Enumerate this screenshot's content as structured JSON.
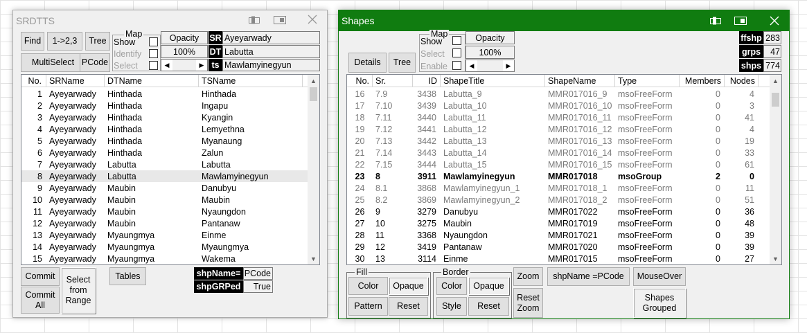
{
  "srdtts": {
    "title": "SRDTTS",
    "buttons": {
      "find": "Find",
      "onetwothree": "1->2,3",
      "tree": "Tree",
      "multiselect": "MultiSelect",
      "pcode": "PCode",
      "commit": "Commit",
      "commit_all": "Commit All",
      "select_from_range": "Select from Range",
      "tables": "Tables"
    },
    "map": {
      "label": "Map",
      "show": "Show",
      "identify": "Identify",
      "select": "Select"
    },
    "opacity": {
      "label": "Opacity",
      "value": "100%"
    },
    "tags": {
      "sr": "SR",
      "dt": "DT",
      "ts": "ts"
    },
    "fields": {
      "sr": "Ayeyarwady",
      "dt": "Labutta",
      "ts": "Mawlamyinegyun"
    },
    "columns": [
      "No.",
      "SRName",
      "DTName",
      "TSName"
    ],
    "rows": [
      [
        "1",
        "Ayeyarwady",
        "Hinthada",
        "Hinthada"
      ],
      [
        "2",
        "Ayeyarwady",
        "Hinthada",
        "Ingapu"
      ],
      [
        "3",
        "Ayeyarwady",
        "Hinthada",
        "Kyangin"
      ],
      [
        "4",
        "Ayeyarwady",
        "Hinthada",
        "Lemyethna"
      ],
      [
        "5",
        "Ayeyarwady",
        "Hinthada",
        "Myanaung"
      ],
      [
        "6",
        "Ayeyarwady",
        "Hinthada",
        "Zalun"
      ],
      [
        "7",
        "Ayeyarwady",
        "Labutta",
        "Labutta"
      ],
      [
        "8",
        "Ayeyarwady",
        "Labutta",
        "Mawlamyinegyun"
      ],
      [
        "9",
        "Ayeyarwady",
        "Maubin",
        "Danubyu"
      ],
      [
        "10",
        "Ayeyarwady",
        "Maubin",
        "Maubin"
      ],
      [
        "11",
        "Ayeyarwady",
        "Maubin",
        "Nyaungdon"
      ],
      [
        "12",
        "Ayeyarwady",
        "Maubin",
        "Pantanaw"
      ],
      [
        "13",
        "Ayeyarwady",
        "Myaungmya",
        "Einme"
      ],
      [
        "14",
        "Ayeyarwady",
        "Myaungmya",
        "Myaungmya"
      ],
      [
        "15",
        "Ayeyarwady",
        "Myaungmya",
        "Wakema"
      ]
    ],
    "selected_row": 7,
    "shpname": {
      "label": "shpName=",
      "value": "PCode"
    },
    "shpgrped": {
      "label": "shpGRPed",
      "value": "True"
    }
  },
  "shapes": {
    "title": "Shapes",
    "accent": "#107c10",
    "buttons": {
      "details": "Details",
      "tree": "Tree",
      "zoom": "Zoom",
      "reset_zoom": "Reset Zoom",
      "shpname_pcode": "shpName =PCode",
      "mouseover": "MouseOver",
      "shapes_grouped": "Shapes Grouped"
    },
    "map": {
      "label": "Map",
      "show": "Show",
      "select": "Select",
      "enable": "Enable"
    },
    "opacity": {
      "label": "Opacity",
      "value": "100%"
    },
    "stats": [
      {
        "label": "ffshp",
        "value": "283"
      },
      {
        "label": "grps",
        "value": "47"
      },
      {
        "label": "shps",
        "value": "774"
      }
    ],
    "columns": [
      "No.",
      "Sr.",
      "ID",
      "ShapeTitle",
      "ShapeName",
      "Type",
      "Members",
      "Nodes"
    ],
    "rows": [
      {
        "c": [
          "16",
          "7.9",
          "3438",
          "Labutta_9",
          "MMR017016_9",
          "msoFreeForm",
          "0",
          "4"
        ],
        "s": "gray"
      },
      {
        "c": [
          "17",
          "7.10",
          "3439",
          "Labutta_10",
          "MMR017016_10",
          "msoFreeForm",
          "0",
          "3"
        ],
        "s": "gray"
      },
      {
        "c": [
          "18",
          "7.11",
          "3440",
          "Labutta_11",
          "MMR017016_11",
          "msoFreeForm",
          "0",
          "41"
        ],
        "s": "gray"
      },
      {
        "c": [
          "19",
          "7.12",
          "3441",
          "Labutta_12",
          "MMR017016_12",
          "msoFreeForm",
          "0",
          "4"
        ],
        "s": "gray"
      },
      {
        "c": [
          "20",
          "7.13",
          "3442",
          "Labutta_13",
          "MMR017016_13",
          "msoFreeForm",
          "0",
          "19"
        ],
        "s": "gray"
      },
      {
        "c": [
          "21",
          "7.14",
          "3443",
          "Labutta_14",
          "MMR017016_14",
          "msoFreeForm",
          "0",
          "33"
        ],
        "s": "gray"
      },
      {
        "c": [
          "22",
          "7.15",
          "3444",
          "Labutta_15",
          "MMR017016_15",
          "msoFreeForm",
          "0",
          "61"
        ],
        "s": "gray"
      },
      {
        "c": [
          "23",
          "8",
          "3911",
          "Mawlamyinegyun",
          "MMR017018",
          "msoGroup",
          "2",
          "0"
        ],
        "s": "bold"
      },
      {
        "c": [
          "24",
          "8.1",
          "3868",
          "Mawlamyinegyun_1",
          "MMR017018_1",
          "msoFreeForm",
          "0",
          "11"
        ],
        "s": "gray"
      },
      {
        "c": [
          "25",
          "8.2",
          "3869",
          "Mawlamyinegyun_2",
          "MMR017018_2",
          "msoFreeForm",
          "0",
          "51"
        ],
        "s": "gray"
      },
      {
        "c": [
          "26",
          "9",
          "3279",
          "Danubyu",
          "MMR017022",
          "msoFreeForm",
          "0",
          "36"
        ],
        "s": ""
      },
      {
        "c": [
          "27",
          "10",
          "3275",
          "Maubin",
          "MMR017019",
          "msoFreeForm",
          "0",
          "48"
        ],
        "s": ""
      },
      {
        "c": [
          "28",
          "11",
          "3368",
          "Nyaungdon",
          "MMR017021",
          "msoFreeForm",
          "0",
          "39"
        ],
        "s": ""
      },
      {
        "c": [
          "29",
          "12",
          "3419",
          "Pantanaw",
          "MMR017020",
          "msoFreeForm",
          "0",
          "39"
        ],
        "s": ""
      },
      {
        "c": [
          "30",
          "13",
          "3114",
          "Einme",
          "MMR017015",
          "msoFreeForm",
          "0",
          "27"
        ],
        "s": ""
      }
    ],
    "fill": {
      "label": "Fill",
      "color": "Color",
      "opaque": "Opaque",
      "pattern": "Pattern",
      "reset": "Reset"
    },
    "border": {
      "label": "Border",
      "color": "Color",
      "opaque": "Opaque",
      "style": "Style",
      "reset": "Reset"
    }
  }
}
